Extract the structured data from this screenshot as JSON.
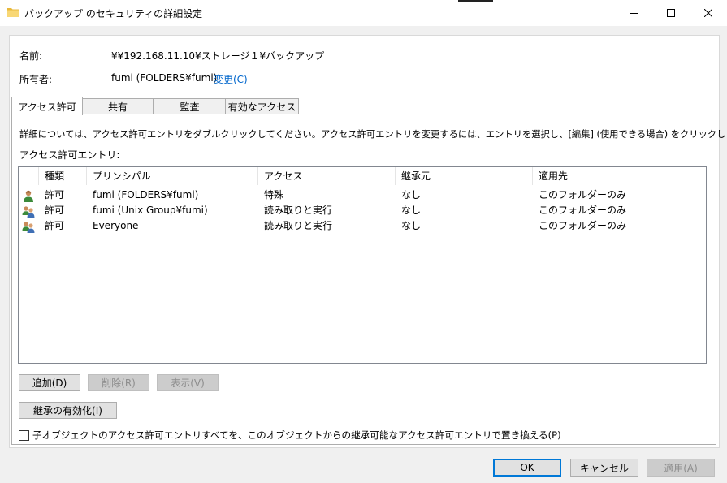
{
  "window": {
    "title": "バックアップ のセキュリティの詳細設定",
    "minimize_label": "—",
    "maximize_label": "☐",
    "close_label": "✕"
  },
  "info": {
    "name_label": "名前:",
    "name_value": "¥¥192.168.11.10¥ストレージ１¥バックアップ",
    "owner_label": "所有者:",
    "owner_value": "fumi (FOLDERS¥fumi)",
    "change_link": "変更(C)"
  },
  "tabs": [
    {
      "label": "アクセス許可",
      "active": true
    },
    {
      "label": "共有",
      "active": false
    },
    {
      "label": "監査",
      "active": false
    },
    {
      "label": "有効なアクセス",
      "active": false
    }
  ],
  "description": "詳細については、アクセス許可エントリをダブルクリックしてください。アクセス許可エントリを変更するには、エントリを選択し、[編集] (使用できる場合) をクリックします。",
  "entries_label": "アクセス許可エントリ:",
  "table": {
    "columns": [
      "種類",
      "プリンシパル",
      "アクセス",
      "継承元",
      "適用先"
    ],
    "rows": [
      {
        "icon": "user-icon",
        "type": "許可",
        "principal": "fumi (FOLDERS¥fumi)",
        "access": "特殊",
        "inherited": "なし",
        "applies": "このフォルダーのみ"
      },
      {
        "icon": "group-icon",
        "type": "許可",
        "principal": "fumi (Unix Group¥fumi)",
        "access": "読み取りと実行",
        "inherited": "なし",
        "applies": "このフォルダーのみ"
      },
      {
        "icon": "group-icon",
        "type": "許可",
        "principal": "Everyone",
        "access": "読み取りと実行",
        "inherited": "なし",
        "applies": "このフォルダーのみ"
      }
    ]
  },
  "buttons": {
    "add": "追加(D)",
    "remove": "削除(R)",
    "view": "表示(V)",
    "enable_inheritance": "継承の有効化(I)",
    "ok": "OK",
    "cancel": "キャンセル",
    "apply": "適用(A)"
  },
  "replace_checkbox": {
    "label": "子オブジェクトのアクセス許可エントリすべてを、このオブジェクトからの継承可能なアクセス許可エントリで置き換える(P)",
    "checked": false
  }
}
